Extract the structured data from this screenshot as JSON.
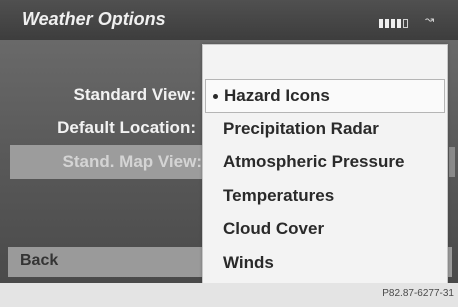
{
  "header": {
    "title": "Weather Options",
    "status_icons": [
      "signal-strength-icon",
      "navigation-arrow-icon"
    ]
  },
  "settings": {
    "standard_view_label": "Standard View:",
    "default_location_label": "Default Location:",
    "stand_map_view_label": "Stand. Map View:"
  },
  "dropdown": {
    "options": [
      {
        "label": "Hazard Icons",
        "selected": true
      },
      {
        "label": "Precipitation Radar",
        "selected": false
      },
      {
        "label": "Atmospheric Pressure",
        "selected": false
      },
      {
        "label": "Temperatures",
        "selected": false
      },
      {
        "label": "Cloud Cover",
        "selected": false
      },
      {
        "label": "Winds",
        "selected": false
      }
    ]
  },
  "footer": {
    "back_label": "Back",
    "image_code": "P82.87-6277-31"
  },
  "colors": {
    "header_bg": "#3d3d3d",
    "screen_bg": "#5a5a5a",
    "dropdown_bg": "#f3f3f3",
    "selected_row_bg": "#9c9c9c"
  }
}
